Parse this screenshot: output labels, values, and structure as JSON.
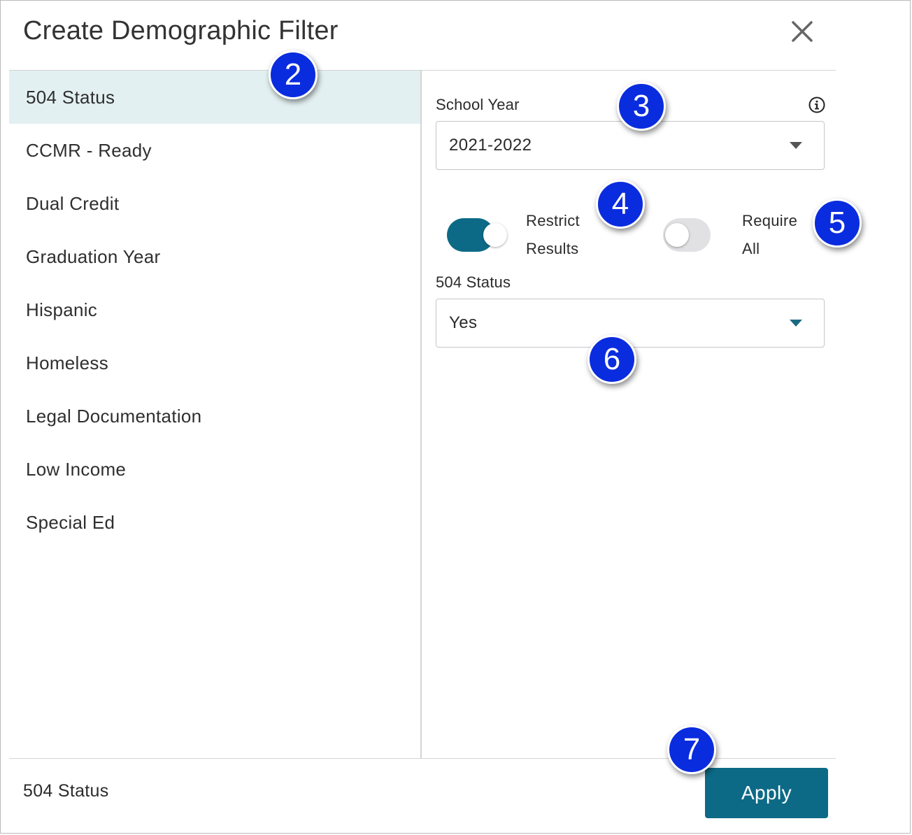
{
  "dialog": {
    "title": "Create Demographic Filter",
    "close_icon": "close-icon"
  },
  "categories": [
    {
      "label": "504 Status",
      "selected": true
    },
    {
      "label": "CCMR - Ready",
      "selected": false
    },
    {
      "label": "Dual Credit",
      "selected": false
    },
    {
      "label": "Graduation Year",
      "selected": false
    },
    {
      "label": "Hispanic",
      "selected": false
    },
    {
      "label": "Homeless",
      "selected": false
    },
    {
      "label": "Legal Documentation",
      "selected": false
    },
    {
      "label": "Low Income",
      "selected": false
    },
    {
      "label": "Special Ed",
      "selected": false
    }
  ],
  "settings": {
    "school_year": {
      "label": "School Year",
      "value": "2021-2022",
      "info_icon": "info-icon"
    },
    "restrict_results": {
      "label_line1": "Restrict",
      "label_line2": "Results",
      "on": true
    },
    "require_all": {
      "label_line1": "Require",
      "label_line2": "All",
      "on": false
    },
    "status_field": {
      "label": "504 Status",
      "value": "Yes"
    }
  },
  "footer": {
    "selected_summary": "504 Status",
    "apply_label": "Apply"
  },
  "callouts": [
    "2",
    "3",
    "4",
    "5",
    "6",
    "7"
  ],
  "colors": {
    "accent": "#0d6a86",
    "selected_row": "#e3f0f1",
    "toggle_off": "#e1e1e4",
    "callout": "#0a2cdf"
  }
}
